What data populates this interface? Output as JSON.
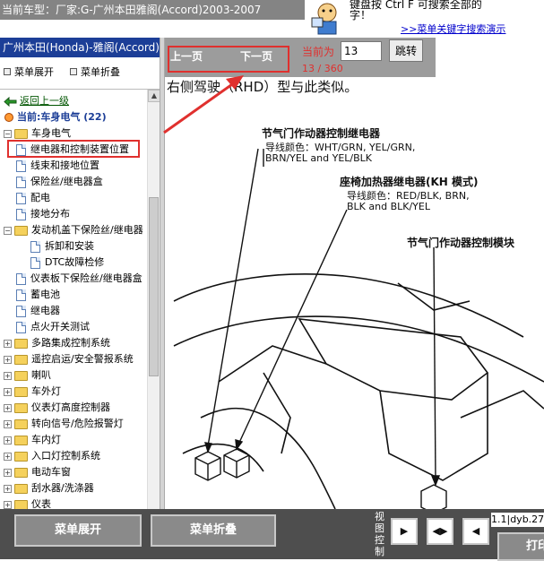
{
  "header": {
    "car_model": "当前车型：厂家:G-广州本田雅阁(Accord)2003-2007",
    "promo_line1": "键盘按  Ctrl F  可搜索全部的",
    "promo_line2": "字！",
    "promo_link": ">>菜单关键字搜索演示"
  },
  "sidebar": {
    "header": "广州本田(Honda)-雅阁(Accord)-2",
    "expand_label": "菜单展开",
    "collapse_label": "菜单折叠",
    "back_label": "返回上一级",
    "current_label": "当前:车身电气 (22)",
    "items": [
      {
        "label": "车身电气",
        "kind": "folder-open"
      },
      {
        "label": "继电器和控制装置位置",
        "kind": "doc",
        "selected": true
      },
      {
        "label": "线束和接地位置",
        "kind": "doc"
      },
      {
        "label": "保险丝/继电器盒",
        "kind": "doc"
      },
      {
        "label": "配电",
        "kind": "doc"
      },
      {
        "label": "接地分布",
        "kind": "doc"
      },
      {
        "label": "发动机盖下保险丝/继电器",
        "kind": "folder-open"
      },
      {
        "label": "拆卸和安装",
        "kind": "doc"
      },
      {
        "label": "DTC故障检修",
        "kind": "doc"
      },
      {
        "label": "仪表板下保险丝/继电器盒",
        "kind": "doc"
      },
      {
        "label": "蓄电池",
        "kind": "doc"
      },
      {
        "label": "继电器",
        "kind": "doc"
      },
      {
        "label": "点火开关测试",
        "kind": "doc"
      },
      {
        "label": "多路集成控制系统",
        "kind": "folder"
      },
      {
        "label": "遥控启运/安全警报系统",
        "kind": "folder"
      },
      {
        "label": "喇叭",
        "kind": "folder"
      },
      {
        "label": "车外灯",
        "kind": "folder"
      },
      {
        "label": "仪表灯高度控制器",
        "kind": "folder"
      },
      {
        "label": "转向信号/危险报警灯",
        "kind": "folder"
      },
      {
        "label": "车内灯",
        "kind": "folder"
      },
      {
        "label": "入口灯控制系统",
        "kind": "folder"
      },
      {
        "label": "电动车窗",
        "kind": "folder"
      },
      {
        "label": "刮水器/洗涤器",
        "kind": "folder"
      },
      {
        "label": "仪表",
        "kind": "folder"
      }
    ]
  },
  "nav": {
    "prev_label": "上一页",
    "next_label": "下一页",
    "current_page_label": "当前为",
    "page_value": "13",
    "jump_label": "跳转",
    "page_count": "13 / 360"
  },
  "diagram": {
    "top_text": "右侧驾驶（RHD）型与此类似。",
    "label1_title": "节气门作动器控制继电器",
    "label1_sub1": "导线颜色：WHT/GRN, YEL/GRN,",
    "label1_sub2": "BRN/YEL and YEL/BLK",
    "label2_title": "座椅加热器继电器(KH 模式)",
    "label2_sub1": "导线颜色：RED/BLK, BRN,",
    "label2_sub2": "BLK and BLK/YEL",
    "label3_title": "节气门作动器控制模块"
  },
  "footer": {
    "expand_label": "菜单展开",
    "collapse_label": "菜单折叠",
    "view_label": "视图控制",
    "ver_text": "1.1|dyb.27",
    "print_label": "打印"
  },
  "colors": {
    "highlight_red": "#e0302e",
    "nav_blue": "#1c3e97",
    "toolbar_gray": "#9c9c9c"
  }
}
